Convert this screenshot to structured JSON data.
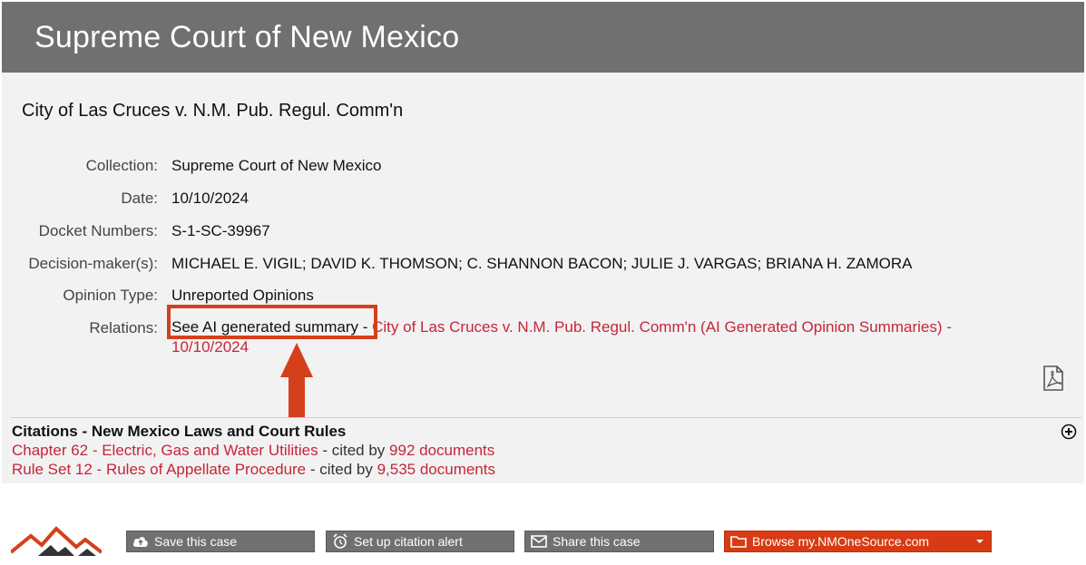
{
  "header": {
    "title": "Supreme Court of New Mexico"
  },
  "case": {
    "title": "City of Las Cruces v. N.M. Pub. Regul. Comm'n",
    "fields": {
      "collection": {
        "label": "Collection:",
        "value": "Supreme Court of New Mexico"
      },
      "date": {
        "label": "Date:",
        "value": "10/10/2024"
      },
      "docket": {
        "label": "Docket Numbers:",
        "value": "S-1-SC-39967"
      },
      "decision_makers": {
        "label": "Decision-maker(s):",
        "value": "MICHAEL E. VIGIL; DAVID K. THOMSON; C. SHANNON BACON; JULIE J. VARGAS; BRIANA H. ZAMORA"
      },
      "opinion_type": {
        "label": "Opinion Type:",
        "value": "Unreported Opinions"
      },
      "relations": {
        "label": "Relations:",
        "prefix": "See AI generated summary",
        "sep": " - ",
        "link": "City of Las Cruces v. N.M. Pub. Regul. Comm'n (AI Generated Opinion Summaries) - 10/10/2024"
      }
    }
  },
  "citations": {
    "title": "Citations - New Mexico Laws and Court Rules",
    "items": [
      {
        "name": "Chapter 62 - Electric, Gas and Water Utilities",
        "cited_by": " - cited by ",
        "count": "992 documents"
      },
      {
        "name": "Rule Set 12 - Rules of Appellate Procedure",
        "cited_by": " - cited by ",
        "count": "9,535 documents"
      }
    ]
  },
  "footer": {
    "save": "Save this case",
    "alert": "Set up citation alert",
    "share": "Share this case",
    "browse": "Browse my.NMOneSource.com"
  },
  "colors": {
    "header": "#717070",
    "link": "#c4263a",
    "highlight": "#d4401a",
    "browse": "#d83b14"
  }
}
